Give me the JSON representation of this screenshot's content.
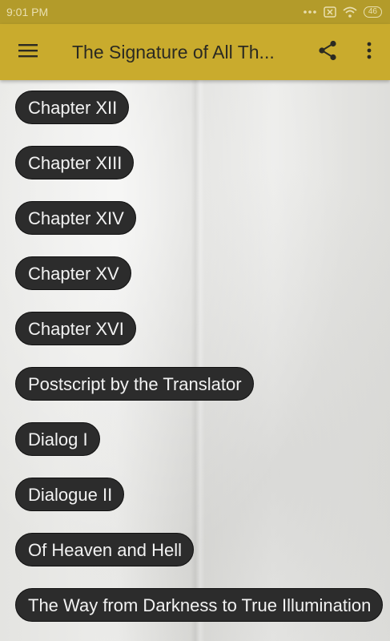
{
  "status_bar": {
    "time": "9:01 PM",
    "battery": "46"
  },
  "app_bar": {
    "title": "The Signature of All Th...",
    "icons": [
      "menu-icon",
      "share-icon",
      "more-vert-icon"
    ]
  },
  "colors": {
    "status_bar": "#b39b2a",
    "app_bar": "#c9ab2d",
    "button_bg": "#2c2c2c",
    "button_text": "#f2f2f2"
  },
  "chapters": [
    {
      "label": "Chapter XII"
    },
    {
      "label": "Chapter XIII"
    },
    {
      "label": "Chapter XIV"
    },
    {
      "label": "Chapter XV"
    },
    {
      "label": "Chapter XVI"
    },
    {
      "label": "Postscript by the Translator"
    },
    {
      "label": "Dialog I"
    },
    {
      "label": "Dialogue II"
    },
    {
      "label": "Of Heaven and Hell"
    },
    {
      "label": "The Way from Darkness to True Illumination"
    }
  ]
}
